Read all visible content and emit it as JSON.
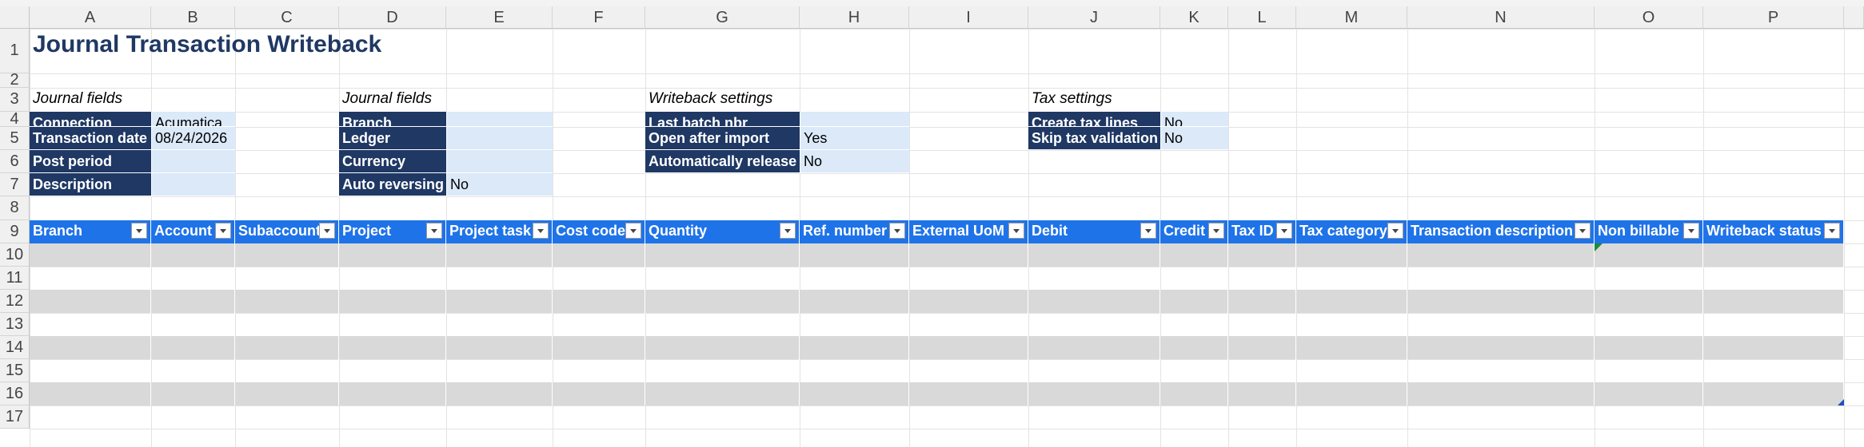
{
  "columns": [
    "A",
    "B",
    "C",
    "D",
    "E",
    "F",
    "G",
    "H",
    "I",
    "J",
    "K",
    "L",
    "M",
    "N",
    "O",
    "P"
  ],
  "rows": [
    "1",
    "2",
    "3",
    "4",
    "5",
    "6",
    "7",
    "8",
    "9",
    "10",
    "11",
    "12",
    "13",
    "14",
    "15",
    "16",
    "17"
  ],
  "title": "Journal Transaction Writeback",
  "sections": {
    "journal1": {
      "heading": "Journal fields",
      "fields": [
        {
          "label": "Connection",
          "value": "Acumatica"
        },
        {
          "label": "Transaction date",
          "value": "08/24/2026"
        },
        {
          "label": "Post period",
          "value": ""
        },
        {
          "label": "Description",
          "value": ""
        }
      ]
    },
    "journal2": {
      "heading": "Journal fields",
      "fields": [
        {
          "label": "Branch",
          "value": ""
        },
        {
          "label": "Ledger",
          "value": ""
        },
        {
          "label": "Currency",
          "value": ""
        },
        {
          "label": "Auto reversing",
          "value": "No"
        }
      ]
    },
    "writeback": {
      "heading": "Writeback settings",
      "fields": [
        {
          "label": "Last batch nbr",
          "value": ""
        },
        {
          "label": "Open after import",
          "value": "Yes"
        },
        {
          "label": "Automatically release",
          "value": "No"
        }
      ]
    },
    "tax": {
      "heading": "Tax settings",
      "fields": [
        {
          "label": "Create tax lines",
          "value": "No"
        },
        {
          "label": "Skip tax validation",
          "value": "No"
        }
      ]
    }
  },
  "table": {
    "headers": [
      "Branch",
      "Account",
      "Subaccount",
      "Project",
      "Project task",
      "Cost code",
      "Quantity",
      "Ref. number",
      "External UoM",
      "Debit",
      "Credit",
      "Tax ID",
      "Tax category",
      "Transaction description",
      "Non billable",
      "Writeback status"
    ]
  },
  "colors": {
    "label_bg": "#1f3864",
    "value_bg": "#dbe9f9",
    "table_header_bg": "#1f73e8",
    "band_gray": "#d9d9d9",
    "title_color": "#1f3864"
  }
}
